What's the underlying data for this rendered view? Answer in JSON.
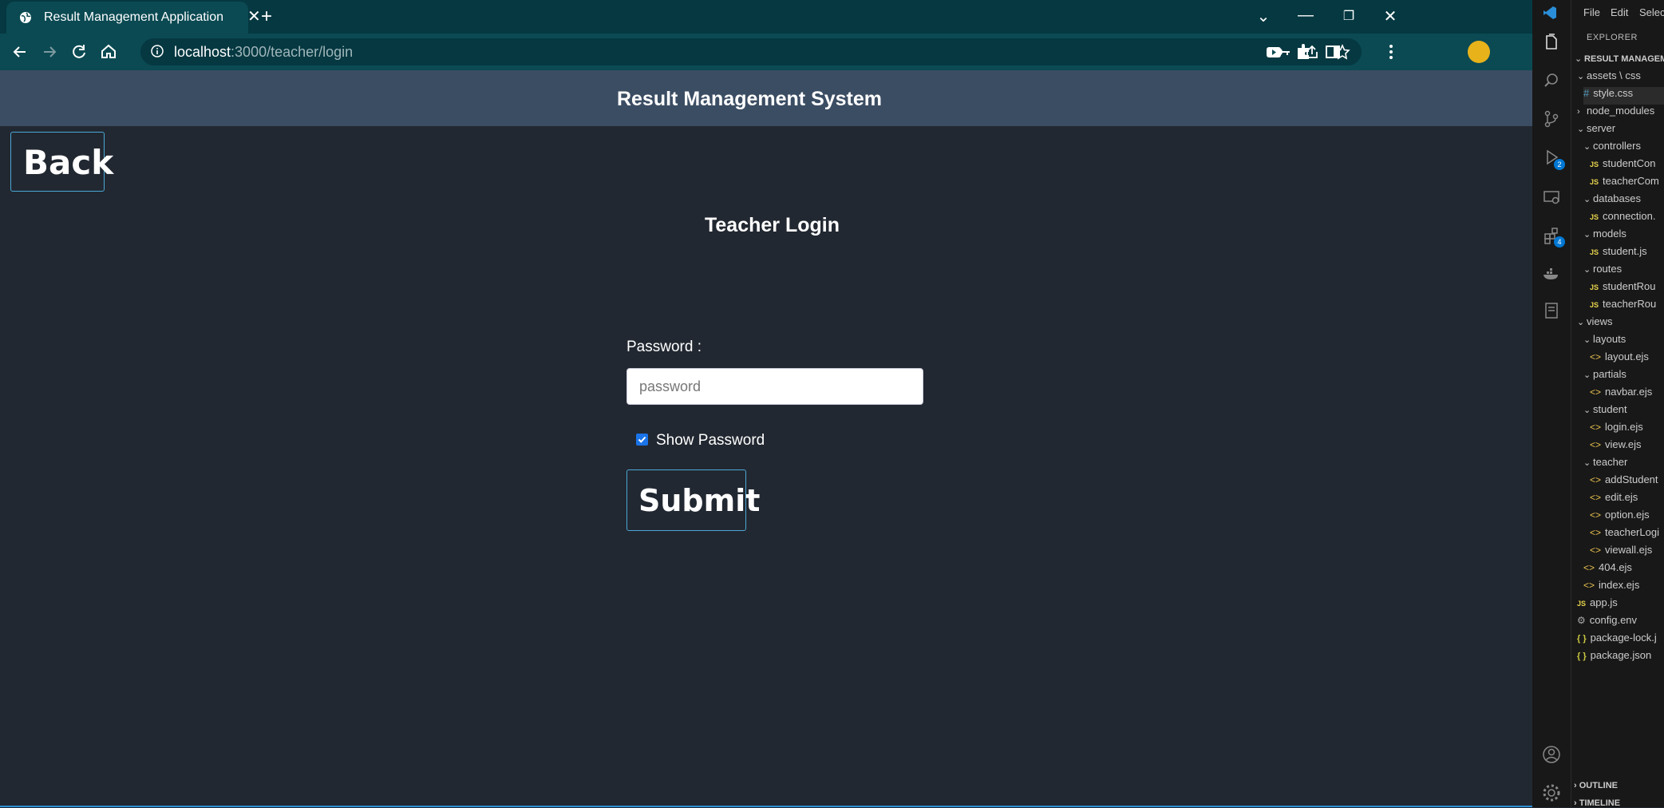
{
  "browser": {
    "tab_title": "Result Management Application",
    "url_host": "localhost",
    "url_path": ":3000/teacher/login"
  },
  "page": {
    "brand": "Result Management System",
    "back_label": "Back",
    "title": "Teacher Login",
    "password_label": "Password :",
    "password_placeholder": "password",
    "show_password_label": "Show Password",
    "show_password_checked": true,
    "submit_label": "Submit"
  },
  "vscode": {
    "menu": [
      "File",
      "Edit",
      "Selection"
    ],
    "explorer_title": "EXPLORER",
    "section_title": "RESULT MANAGEM",
    "badges": {
      "run": "2",
      "extensions": "4"
    },
    "tree": [
      {
        "label": "assets \\ css",
        "type": "folder"
      },
      {
        "label": "style.css",
        "type": "css"
      },
      {
        "label": "node_modules",
        "type": "folder-closed"
      },
      {
        "label": "server",
        "type": "folder"
      },
      {
        "label": "controllers",
        "type": "folder"
      },
      {
        "label": "studentCon",
        "type": "js"
      },
      {
        "label": "teacherCom",
        "type": "js"
      },
      {
        "label": "databases",
        "type": "folder"
      },
      {
        "label": "connection.",
        "type": "js"
      },
      {
        "label": "models",
        "type": "folder"
      },
      {
        "label": "student.js",
        "type": "js"
      },
      {
        "label": "routes",
        "type": "folder"
      },
      {
        "label": "studentRou",
        "type": "js"
      },
      {
        "label": "teacherRou",
        "type": "js"
      },
      {
        "label": "views",
        "type": "folder"
      },
      {
        "label": "layouts",
        "type": "folder"
      },
      {
        "label": "layout.ejs",
        "type": "ejs"
      },
      {
        "label": "partials",
        "type": "folder"
      },
      {
        "label": "navbar.ejs",
        "type": "ejs"
      },
      {
        "label": "student",
        "type": "folder"
      },
      {
        "label": "login.ejs",
        "type": "ejs"
      },
      {
        "label": "view.ejs",
        "type": "ejs"
      },
      {
        "label": "teacher",
        "type": "folder"
      },
      {
        "label": "addStudent",
        "type": "ejs"
      },
      {
        "label": "edit.ejs",
        "type": "ejs"
      },
      {
        "label": "option.ejs",
        "type": "ejs"
      },
      {
        "label": "teacherLogi",
        "type": "ejs"
      },
      {
        "label": "viewall.ejs",
        "type": "ejs"
      },
      {
        "label": "404.ejs",
        "type": "ejs"
      },
      {
        "label": "index.ejs",
        "type": "ejs"
      },
      {
        "label": "app.js",
        "type": "js"
      },
      {
        "label": "config.env",
        "type": "gear"
      },
      {
        "label": "package-lock.j",
        "type": "json"
      },
      {
        "label": "package.json",
        "type": "json"
      }
    ],
    "outline": "OUTLINE",
    "timeline": "TIMELINE"
  }
}
